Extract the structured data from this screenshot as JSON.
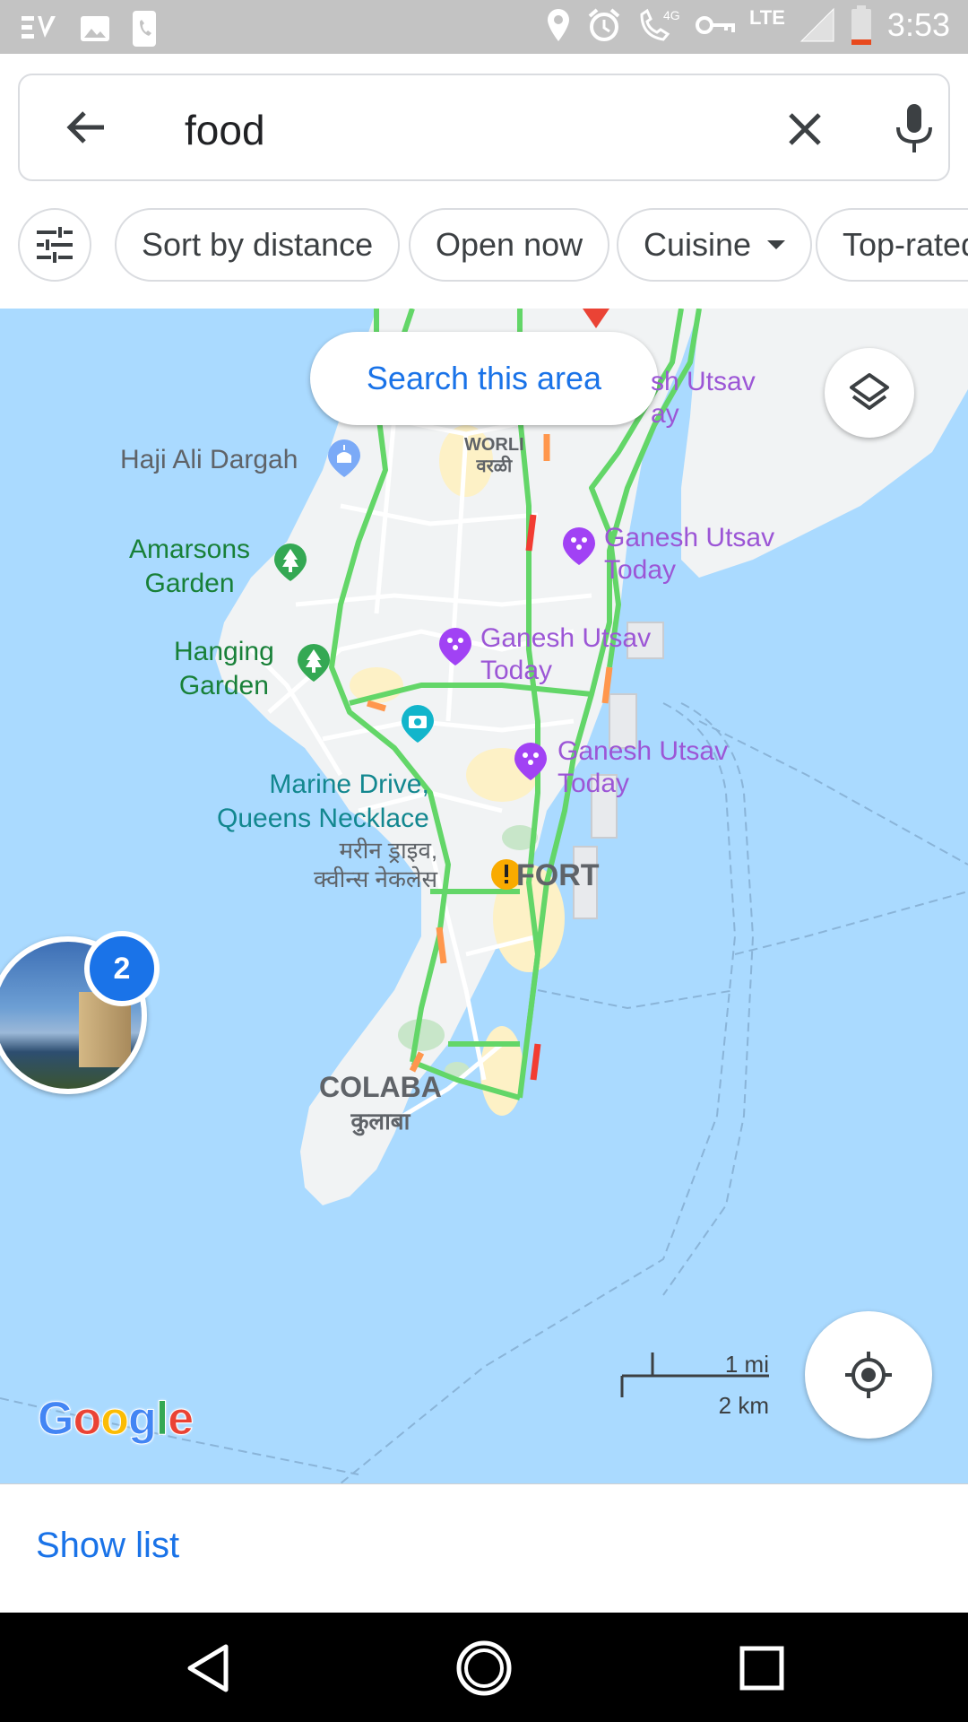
{
  "status_bar": {
    "time": "3:53",
    "network": "LTE",
    "icons": [
      "ev-app-icon",
      "image-icon",
      "phone-icon",
      "location-icon",
      "alarm-icon",
      "volte-call-icon",
      "vpn-key-icon",
      "signal-icon",
      "battery-low-icon"
    ]
  },
  "search": {
    "query": "food",
    "back_icon": "arrow-back-icon",
    "clear_icon": "close-icon",
    "mic_icon": "mic-icon"
  },
  "chips": {
    "filter_icon": "tune-icon",
    "sort": "Sort by distance",
    "open_now": "Open now",
    "cuisine": "Cuisine",
    "top_rated": "Top-rated"
  },
  "map": {
    "search_area_button": "Search this area",
    "labels": {
      "haji_ali": "Haji Ali Dargah",
      "worli": "WORLI",
      "worli_local": "वरळी",
      "amarsons_1": "Amarsons",
      "amarsons_2": "Garden",
      "hanging_1": "Hanging",
      "hanging_2": "Garden",
      "marine_1": "Marine Drive,",
      "marine_2": "Queens Necklace",
      "marine_3": "मरीन ड्राइव,",
      "marine_4": "क्वीन्स नेकलेस",
      "fort": "FORT",
      "colaba": "COLABA",
      "colaba_local": "कुलाबा",
      "ganesh_top": "sh Utsav",
      "ganesh_top_sub": "ay",
      "ganesh_name": "Ganesh Utsav",
      "ganesh_today": "Today"
    },
    "photo_count": "2",
    "scale_mi": "1 mi",
    "scale_km": "2 km",
    "google_logo": "Google",
    "colors": {
      "water": "#aadaff",
      "land": "#f1f3f4",
      "traffic_green": "#63d668",
      "traffic_orange": "#ff974d",
      "traffic_red": "#f23c32",
      "accent_blue": "#1a73e8",
      "poi_purple": "#9c56d6"
    }
  },
  "bottom_sheet": {
    "show_list": "Show list"
  },
  "nav": {
    "back_icon": "nav-back-icon",
    "home_icon": "nav-home-icon",
    "recents_icon": "nav-recents-icon"
  }
}
